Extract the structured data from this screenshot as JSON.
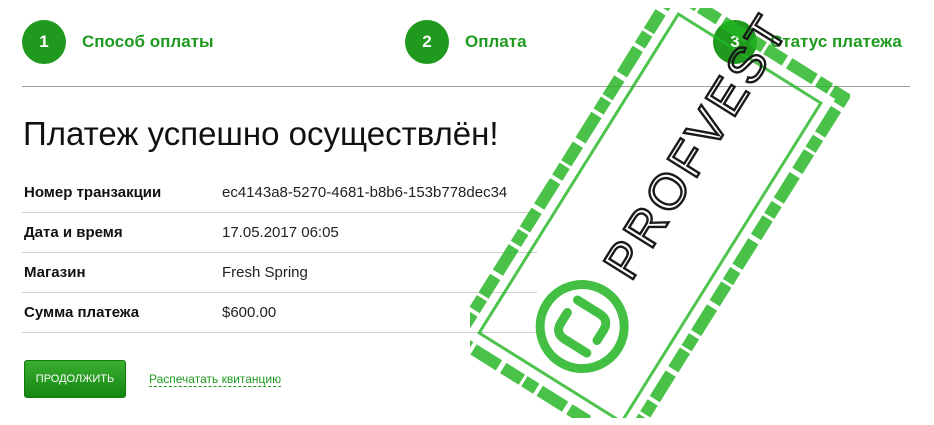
{
  "steps": [
    {
      "number": "1",
      "label": "Способ оплаты"
    },
    {
      "number": "2",
      "label": "Оплата"
    },
    {
      "number": "3",
      "label": "Статус платежа"
    }
  ],
  "title": "Платеж успешно осуществлён!",
  "details": [
    {
      "label": "Номер транзакции",
      "value": "ec4143a8-5270-4681-b8b6-153b778dec34"
    },
    {
      "label": "Дата и время",
      "value": "17.05.2017 06:05"
    },
    {
      "label": "Магазин",
      "value": "Fresh Spring"
    },
    {
      "label": "Сумма платежа",
      "value": "$600.00"
    }
  ],
  "actions": {
    "continue_label": "Продолжить",
    "print_label": "Распечатать квитанцию"
  },
  "stamp": {
    "text": "PROFVEST",
    "color": "#22b422"
  },
  "colors": {
    "accent": "#1f9a1f"
  }
}
